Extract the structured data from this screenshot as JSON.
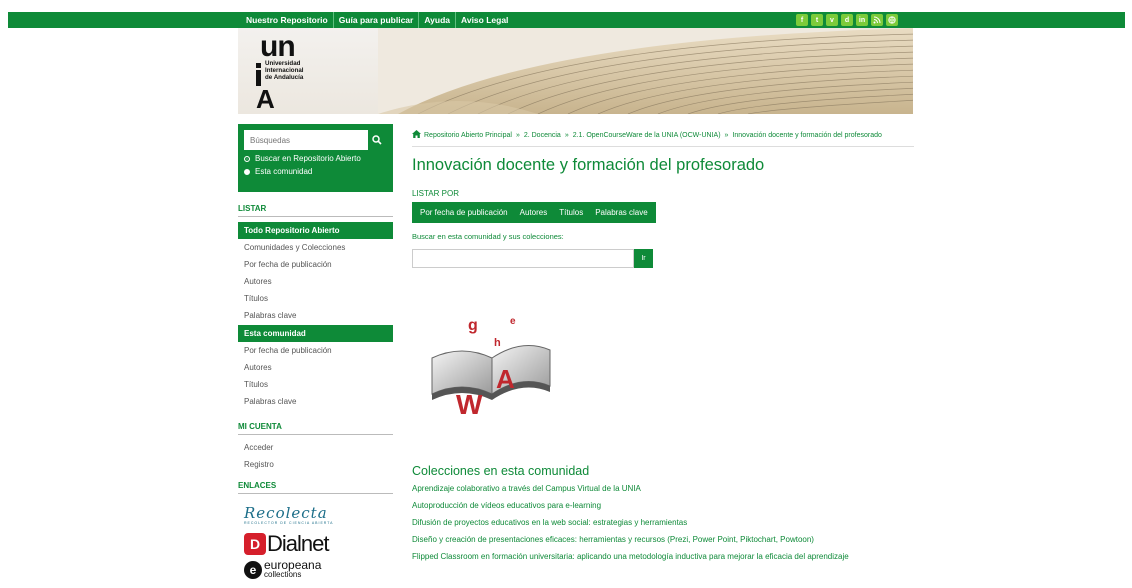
{
  "topnav": {
    "links": [
      "Nuestro Repositorio",
      "Guía para publicar",
      "Ayuda",
      "Aviso Legal"
    ],
    "socials": [
      "f",
      "t",
      "v",
      "d",
      "in",
      "rss",
      "w"
    ]
  },
  "logo": {
    "un": "un",
    "lines": [
      "Universidad",
      "Internacional",
      "de Andalucía"
    ],
    "A": "A"
  },
  "sidebar": {
    "search_placeholder": "Búsquedas",
    "radio1": "Buscar en Repositorio Abierto",
    "radio2": "Esta comunidad",
    "listar_head": "LISTAR",
    "all_repo": "Todo Repositorio Abierto",
    "all_items": [
      "Comunidades y Colecciones",
      "Por fecha de publicación",
      "Autores",
      "Títulos",
      "Palabras clave"
    ],
    "this_comm": "Esta comunidad",
    "comm_items": [
      "Por fecha de publicación",
      "Autores",
      "Títulos",
      "Palabras clave"
    ],
    "account_head": "MI CUENTA",
    "account_items": [
      "Acceder",
      "Registro"
    ],
    "links_head": "ENLACES",
    "recolecta": "Recolecta",
    "recolecta_sub": "RECOLECTOR DE CIENCIA ABIERTA",
    "dialnet_d": "D",
    "dialnet": "Dialnet",
    "europeana_e": "e",
    "europeana1": "europeana",
    "europeana2": "collections"
  },
  "breadcrumb": [
    "Repositorio Abierto Principal",
    "2. Docencia",
    "2.1. OpenCourseWare de la UNIA (OCW-UNIA)",
    "Innovación docente y formación del profesorado"
  ],
  "main": {
    "title": "Innovación docente y formación del profesorado",
    "listar_por": "LISTAR POR",
    "tabs": [
      "Por fecha de publicación",
      "Autores",
      "Títulos",
      "Palabras clave"
    ],
    "scope_label": "Buscar en esta comunidad y sus colecciones:",
    "go": "Ir",
    "collections_title": "Colecciones en esta comunidad",
    "collections": [
      "Aprendizaje colaborativo a través del Campus Virtual de la UNIA",
      "Autoproducción de vídeos educativos para e-learning",
      "Difusión de proyectos educativos en la web social: estrategias y herramientas",
      "Diseño y creación de presentaciones eficaces: herramientas y recursos (Prezi, Power Point, Piktochart, Powtoon)",
      "Flipped Classroom en formación universitaria: aplicando una metodología inductiva para mejorar la eficacia del aprendizaje"
    ]
  },
  "book_letters": [
    "g",
    "e",
    "h",
    "W",
    "A"
  ],
  "colors": {
    "primary": "#0e8a38",
    "social": "#7ccb3a"
  }
}
